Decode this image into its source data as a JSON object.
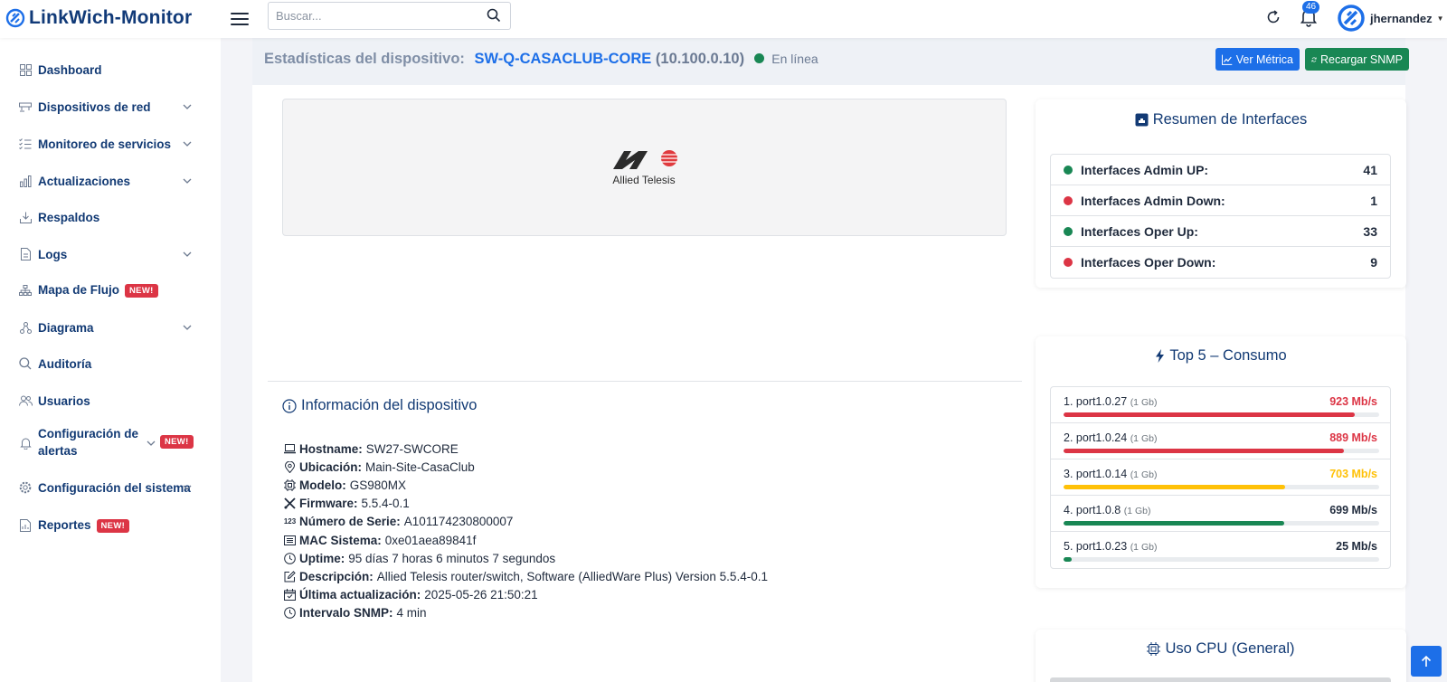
{
  "app": {
    "title": "LinkWich-Monitor",
    "accent": "#1d6fe8",
    "brand_color": "#113a78"
  },
  "topbar": {
    "search_placeholder": "Buscar...",
    "notification_count": "46",
    "username": "jhernandez"
  },
  "sidebar": {
    "items": [
      {
        "label": "Dashboard",
        "icon": "grid-icon"
      },
      {
        "label": "Dispositivos de red",
        "icon": "router-icon",
        "chevron": true
      },
      {
        "label": "Monitoreo de servicios",
        "icon": "list-check-icon",
        "chevron": true
      },
      {
        "label": "Actualizaciones",
        "icon": "bar-chart-icon",
        "chevron": true
      },
      {
        "label": "Respaldos",
        "icon": "download-icon"
      },
      {
        "label": "Logs",
        "icon": "file-icon",
        "chevron": true
      },
      {
        "label": "Mapa de Flujo",
        "icon": "sitemap-icon",
        "badge": "NEW!"
      },
      {
        "label": "Diagrama",
        "icon": "diagram-icon",
        "chevron": true
      },
      {
        "label": "Auditoría",
        "icon": "search-icon"
      },
      {
        "label": "Usuarios",
        "icon": "users-icon"
      },
      {
        "label": "Configuración de alertas",
        "label_line1": "Configuración de",
        "label_line2": "alertas",
        "icon": "bell-icon",
        "chevron": true,
        "badge": "NEW!"
      },
      {
        "label": "Configuración del sistema",
        "icon": "gear-icon",
        "chevron": true
      },
      {
        "label": "Reportes",
        "icon": "report-icon",
        "badge": "NEW!"
      }
    ]
  },
  "header": {
    "prefix": "Estadísticas del dispositivo:",
    "device_name": "SW-Q-CASACLUB-CORE",
    "device_ip": "(10.100.0.10)",
    "status": "En línea",
    "btn_metric": "Ver Métrica",
    "btn_reload": "Recargar SNMP"
  },
  "device": {
    "logo_text": "Allied Telesis",
    "info_title": "Información del dispositivo",
    "info": [
      {
        "label": "Hostname:",
        "value": "SW27-SWCORE",
        "icon": "laptop-icon"
      },
      {
        "label": "Ubicación:",
        "value": "Main-Site-CasaClub",
        "icon": "location-icon"
      },
      {
        "label": "Modelo:",
        "value": "GS980MX",
        "icon": "chip-icon"
      },
      {
        "label": "Firmware:",
        "value": "5.5.4-0.1",
        "icon": "tools-icon"
      },
      {
        "label": "Número de Serie:",
        "value": "A101174230800007",
        "icon": "123-icon",
        "icon_text": "123"
      },
      {
        "label": "MAC Sistema:",
        "value": "0xe01aea89841f",
        "icon": "card-icon"
      },
      {
        "label": "Uptime:",
        "value": "95 días 7 horas 6 minutos 7 segundos",
        "icon": "clock-icon"
      },
      {
        "label": "Descripción:",
        "value": "Allied Telesis router/switch, Software (AlliedWare Plus) Version 5.5.4-0.1",
        "icon": "edit-icon"
      },
      {
        "label": "Última actualización:",
        "value": "2025-05-26 21:50:21",
        "icon": "calendar-check-icon"
      },
      {
        "label": "Intervalo SNMP:",
        "value": "4 min",
        "icon": "clock-icon"
      }
    ]
  },
  "interfaces": {
    "title": "Resumen de Interfaces",
    "rows": [
      {
        "label": "Interfaces Admin UP:",
        "value": "41",
        "color": "#198754"
      },
      {
        "label": "Interfaces Admin Down:",
        "value": "1",
        "color": "#dc3545"
      },
      {
        "label": "Interfaces Oper Up:",
        "value": "33",
        "color": "#198754"
      },
      {
        "label": "Interfaces Oper Down:",
        "value": "9",
        "color": "#dc3545"
      }
    ]
  },
  "top5": {
    "title": "Top 5 – Consumo",
    "rows": [
      {
        "name": "1. port1.0.27",
        "speed": "(1 Gb)",
        "value": "923 Mb/s",
        "fraction": 0.923,
        "color": "#dc3545"
      },
      {
        "name": "2. port1.0.24",
        "speed": "(1 Gb)",
        "value": "889 Mb/s",
        "fraction": 0.889,
        "color": "#dc3545"
      },
      {
        "name": "3. port1.0.14",
        "speed": "(1 Gb)",
        "value": "703 Mb/s",
        "fraction": 0.703,
        "color": "#ffc107"
      },
      {
        "name": "4. port1.0.8",
        "speed": "(1 Gb)",
        "value": "699 Mb/s",
        "fraction": 0.699,
        "color": "#198754"
      },
      {
        "name": "5. port1.0.23",
        "speed": "(1 Gb)",
        "value": "25 Mb/s",
        "fraction": 0.025,
        "color": "#198754"
      }
    ]
  },
  "cpu": {
    "title": "Uso CPU (General)"
  }
}
